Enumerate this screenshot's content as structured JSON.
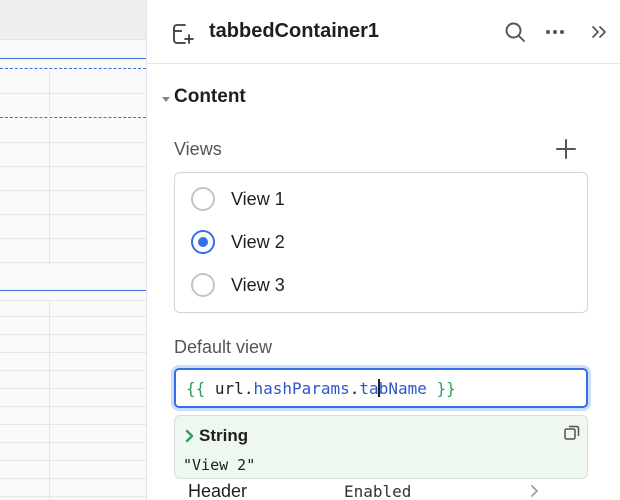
{
  "inspector": {
    "component_name": "tabbedContainer1",
    "icons": {
      "component": "add-container-icon",
      "search": "search-icon",
      "more": "more-horizontal-icon",
      "collapse": "chevrons-right-icon"
    }
  },
  "content_section": {
    "title": "Content",
    "views_label": "Views",
    "views": [
      {
        "label": "View 1",
        "selected": false
      },
      {
        "label": "View 2",
        "selected": true
      },
      {
        "label": "View 3",
        "selected": false
      }
    ],
    "default_view_label": "Default view",
    "default_view_code": {
      "open": "{{",
      "obj": "url",
      "prop1": "hashParams",
      "prop2_before_caret": "ta",
      "prop2_after_caret": "bName",
      "close": "}}"
    },
    "evaluation": {
      "type": "String",
      "value": "\"View 2\""
    },
    "header_row": {
      "label": "Header",
      "value": "Enabled"
    }
  },
  "colors": {
    "accent": "#3170e6",
    "string_bg": "#eef7f0",
    "brace": "#2f9e5e",
    "property": "#2d55c8"
  }
}
